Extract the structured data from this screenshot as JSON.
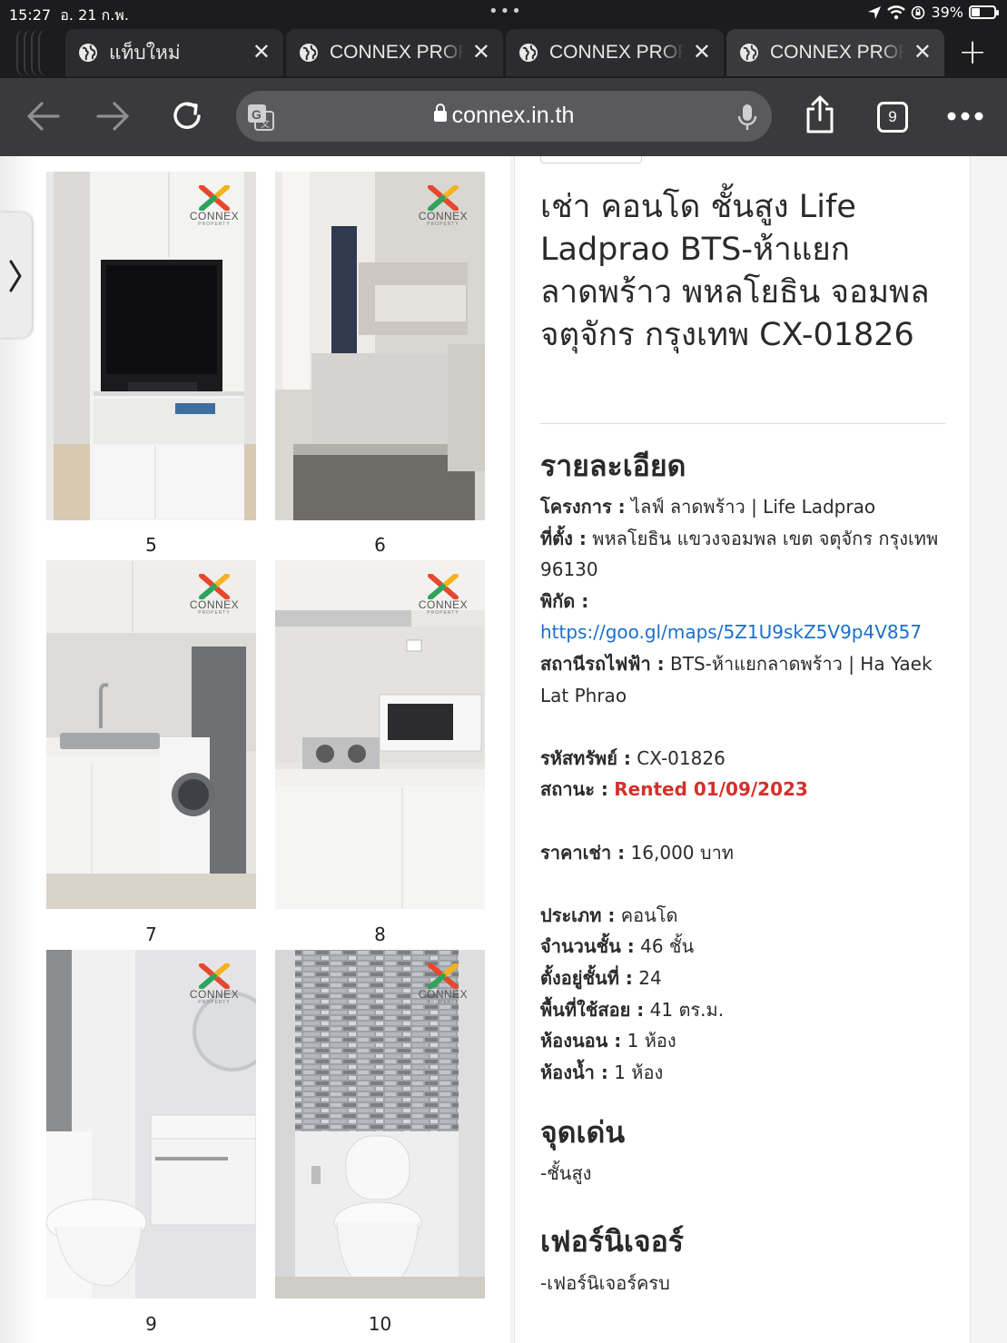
{
  "status_bar": {
    "time": "15:27",
    "date": "อ. 21 ก.พ.",
    "battery": "39%",
    "battery_level": 0.39
  },
  "tabs": [
    {
      "label": "แท็บใหม่",
      "active": false
    },
    {
      "label": "CONNEX PROPERTY",
      "active": false
    },
    {
      "label": "CONNEX PROPERTY",
      "active": false
    },
    {
      "label": "CONNEX PROPERTY",
      "active": true
    }
  ],
  "toolbar": {
    "url": "connex.in.th",
    "tab_count": "9"
  },
  "gallery": {
    "watermark": "CONNEX",
    "watermark_sub": "PROPERTY",
    "captions": [
      "5",
      "6",
      "7",
      "8",
      "9",
      "10"
    ]
  },
  "listing": {
    "title": "เช่า คอนโด ชั้นสูง Life Ladprao BTS-ห้าแยกลาดพร้าว พหลโยธิน จอมพล จตุจักร กรุงเทพ CX-01826",
    "details_heading": "รายละเอียด",
    "project_label": "โครงการ :",
    "project_value": "ไลฟ์ ลาดพร้าว | Life Ladprao",
    "location_label": "ที่ตั้ง :",
    "location_value": "พหลโยธิน แขวงจอมพล เขต จตุจักร กรุงเทพ 96130",
    "coords_label": "พิกัด :",
    "map_link": "https://goo.gl/maps/5Z1U9skZ5V9p4V857",
    "station_label": "สถานีรถไฟฟ้า :",
    "station_value": "BTS-ห้าแยกลาดพร้าว | Ha Yaek Lat Phrao",
    "code_label": "รหัสทรัพย์ :",
    "code_value": "CX-01826",
    "status_label": "สถานะ :",
    "status_value": "Rented 01/09/2023",
    "rent_label": "ราคาเช่า :",
    "rent_value": "16,000 บาท",
    "type_label": "ประเภท :",
    "type_value": "คอนโด",
    "floors_label": "จำนวนชั้น :",
    "floors_value": "46 ชั้น",
    "floor_label": "ตั้งอยู่ชั้นที่ :",
    "floor_value": "24",
    "area_label": "พื้นที่ใช้สอย :",
    "area_value": "41 ตร.ม.",
    "bedroom_label": "ห้องนอน :",
    "bedroom_value": "1 ห้อง",
    "bathroom_label": "ห้องน้ำ :",
    "bathroom_value": "1 ห้อง",
    "highlights_heading": "จุดเด่น",
    "highlights_value": "-ชั้นสูง",
    "furniture_heading": "เฟอร์นิเจอร์",
    "furniture_value": "-เฟอร์นิเจอร์ครบ"
  },
  "colors": {
    "status_rented": "#d4302b",
    "link": "#1a6fcc",
    "chrome_dark": "#1c1c1e",
    "toolbar": "#3a3a3c"
  }
}
